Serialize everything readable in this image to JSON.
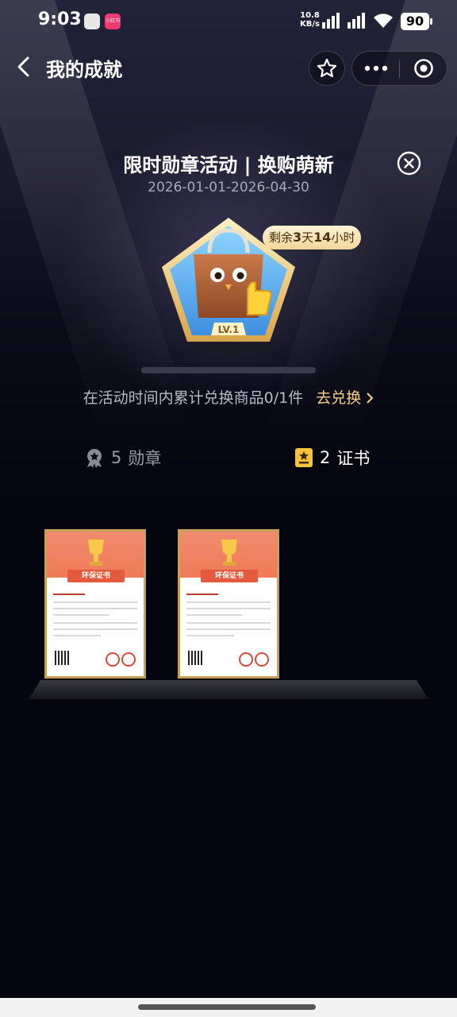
{
  "status": {
    "time": "9:03",
    "app_tag": "小红书",
    "net_speed_value": "10.8",
    "net_speed_unit": "KB/s",
    "battery": "90"
  },
  "nav": {
    "title": "我的成就"
  },
  "activity": {
    "title": "限时勋章活动 | 换购萌新",
    "date_range": "2026-01-01-2026-04-30",
    "remain_prefix": "剩余",
    "remain_days": "3",
    "remain_days_unit": "天",
    "remain_hours": "14",
    "remain_hours_unit": "小时",
    "badge_level": "LV.1",
    "progress_fraction": 0,
    "task_text": "在活动时间内累计兑换商品0/1件",
    "task_link": "去兑换"
  },
  "tabs": {
    "medal_count": "5",
    "medal_label": "勋章",
    "cert_count": "2",
    "cert_label": "证书"
  },
  "certificates": [
    {
      "ribbon": "环保证书"
    },
    {
      "ribbon": "环保证书"
    }
  ]
}
